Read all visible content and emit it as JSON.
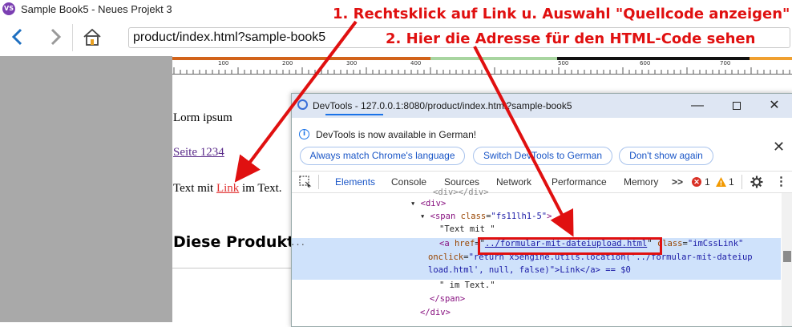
{
  "app": {
    "logo_text": "VS",
    "title": "Sample Book5 - Neues Projekt 3",
    "address": "product/index.html?sample-book5"
  },
  "ruler": {
    "labels": [
      "100",
      "200",
      "300",
      "400",
      "500",
      "600",
      "700"
    ],
    "colors": [
      "#d2631a",
      "#a8d5a0",
      "#111111",
      "#f0a030"
    ]
  },
  "page": {
    "text1": "Lorm ipsum",
    "link1": "Seite 1234",
    "text_before": "Text mit ",
    "link2": "Link",
    "text_after": " im Text.",
    "heading": "Diese Produkt"
  },
  "devtools": {
    "title": "DevTools - 127.0.0.1:8080/product/index.html?sample-book5",
    "info_text": "DevTools is now available in German!",
    "buttons": {
      "match_language": "Always match Chrome's language",
      "switch_german": "Switch DevTools to German",
      "dont_show": "Don't show again"
    },
    "tabs": [
      "Elements",
      "Console",
      "Sources",
      "Network",
      "Performance",
      "Memory"
    ],
    "more_tabs": ">>",
    "error_count": "1",
    "warning_count": "1",
    "code": {
      "line0": "<div></div>",
      "div_open": "div",
      "span_tag": "span",
      "span_attr": "class",
      "span_val": "\"fs11lh1-5\"",
      "text_mit": "\"Text mit \"",
      "a_tag": "a",
      "href_attr": "href",
      "href_val": "../formular-mit-dateiupload.html",
      "class_attr": "class",
      "class_val": "\"imCssLink\"",
      "onclick_attr": "onclick",
      "onclick_val1": "\"return x5engine.utils.location('../formular-mit-dateiup",
      "onclick_val2": "load.html', null, false)\">Link</a> == $0",
      "text_im": "\" im Text.\"",
      "span_close": "</span>",
      "div_close": "</div>",
      "dots": "..."
    }
  },
  "annotations": {
    "step1": "1. Rechtsklick auf Link u. Auswahl \"Quellcode anzeigen\"",
    "step2": "2. Hier die Adresse für den HTML-Code sehen",
    "color": "#e01010"
  }
}
